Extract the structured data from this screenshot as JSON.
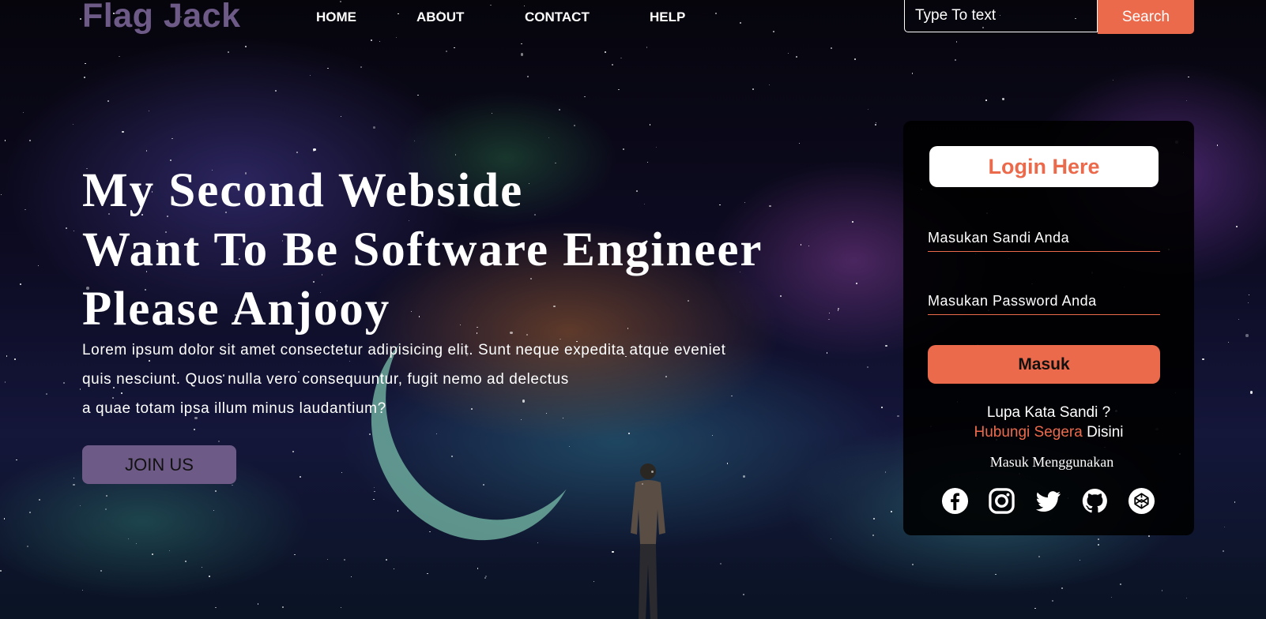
{
  "header": {
    "logo": "Flag Jack",
    "nav": [
      "HOME",
      "ABOUT",
      "CONTACT",
      "HELP"
    ],
    "search": {
      "placeholder": "Type To text",
      "button": "Search"
    }
  },
  "hero": {
    "title_lines": [
      "My Second Webside",
      "Want To Be Software Engineer",
      "Please Anjooy"
    ],
    "text_lines": [
      "Lorem ipsum dolor sit amet consectetur adipisicing elit. Sunt neque expedita atque eveniet",
      "quis nesciunt. Quos nulla vero consequuntur, fugit nemo ad delectus",
      "a quae totam ipsa illum minus laudantium?"
    ],
    "join_button": "JOIN US"
  },
  "login": {
    "title": "Login Here",
    "username_placeholder": "Masukan Sandi Anda",
    "password_placeholder": "Masukan Password Anda",
    "submit": "Masuk",
    "forgot_line": "Lupa Kata Sandi ?",
    "contact_link": "Hubungi Segera",
    "contact_suffix": " Disini",
    "via": "Masuk Menggunakan",
    "socials": [
      "facebook-icon",
      "instagram-icon",
      "twitter-icon",
      "github-icon",
      "codepen-icon"
    ]
  },
  "colors": {
    "accent": "#ec6a4c",
    "brand": "#6e5a87",
    "card": "#000000"
  }
}
